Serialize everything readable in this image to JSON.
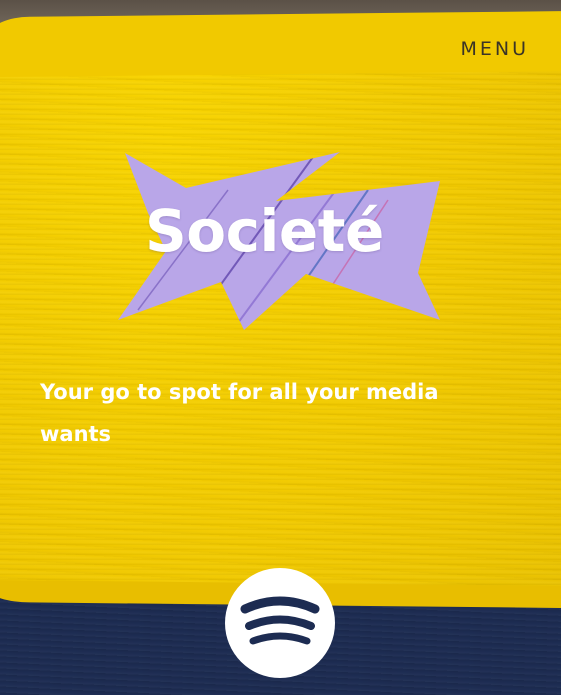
{
  "header": {
    "menu_label": "MENU"
  },
  "hero": {
    "logo_text": "Societé",
    "tagline": "Your go to spot for all your media wants"
  },
  "social": {
    "spotify_icon": "spotify-icon"
  },
  "colors": {
    "wall_yellow": "#f2cd00",
    "band_navy": "#1d2c52",
    "logo_lavender": "#b9a6e8",
    "text_white": "#ffffff",
    "menu_text": "#3a3426"
  }
}
